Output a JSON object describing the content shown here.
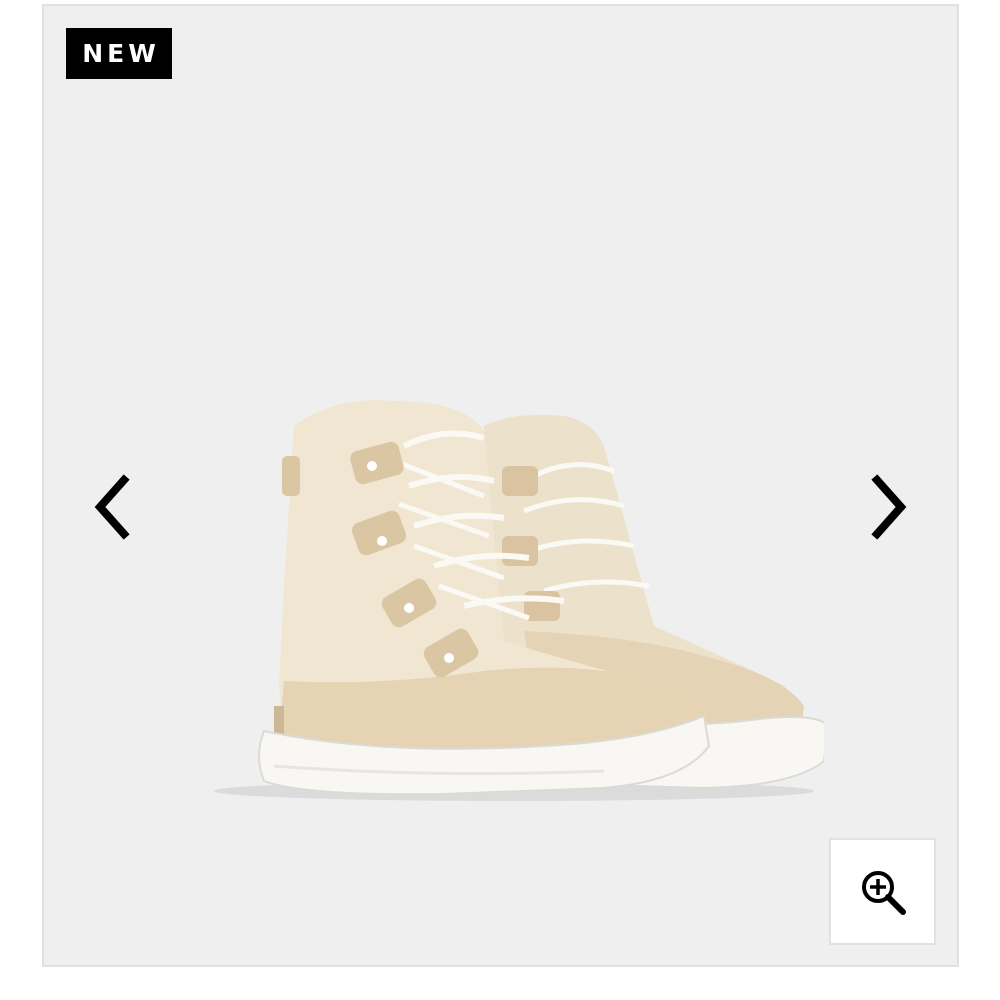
{
  "gallery": {
    "badge_label": "NEW",
    "prev_icon": "chevron-left-icon",
    "next_icon": "chevron-right-icon",
    "zoom_icon": "zoom-in-icon",
    "colors": {
      "background": "#f0eff0",
      "border": "#e1e1e3",
      "badge_bg": "#000000",
      "badge_text": "#ffffff",
      "icon": "#000000"
    }
  }
}
